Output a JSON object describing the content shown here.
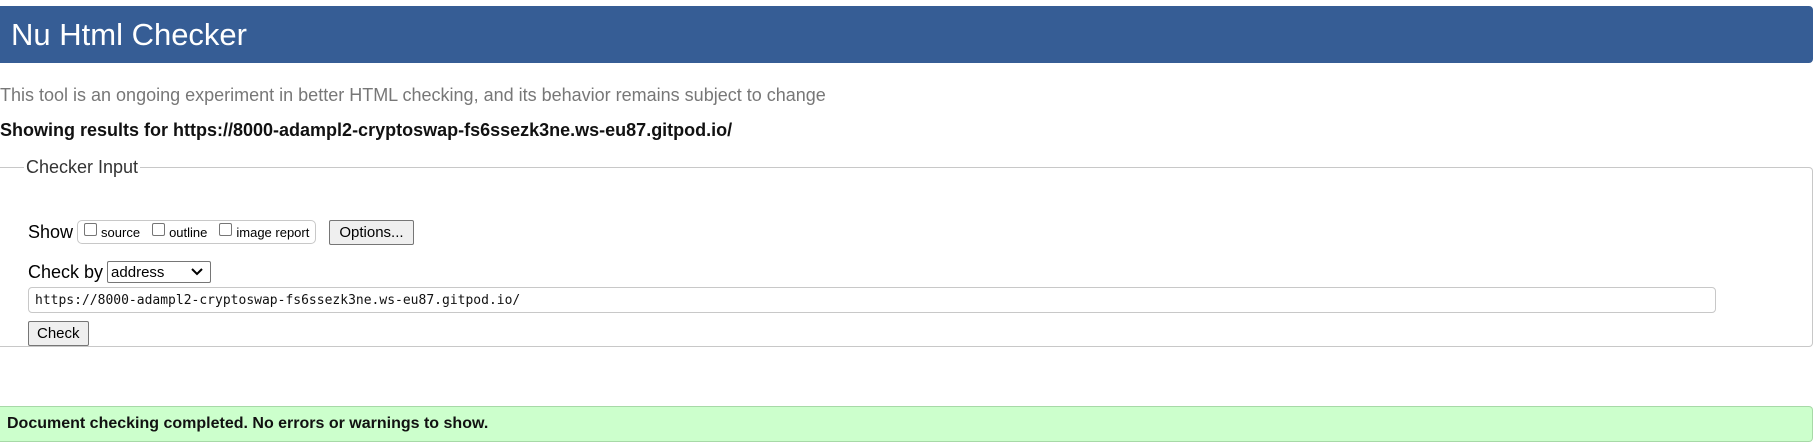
{
  "header": {
    "title": "Nu Html Checker"
  },
  "intro": {
    "subtitle": "This tool is an ongoing experiment in better HTML checking, and its behavior remains subject to change",
    "showing_results": "Showing results for https://8000-adampl2-cryptoswap-fs6ssezk3ne.ws-eu87.gitpod.io/"
  },
  "checker_input": {
    "legend": "Checker Input",
    "show_label": "Show",
    "show_options": [
      {
        "label": "source",
        "checked": false
      },
      {
        "label": "outline",
        "checked": false
      },
      {
        "label": "image report",
        "checked": false
      }
    ],
    "options_button": "Options...",
    "check_by_label": "Check by",
    "check_by_selected": "address",
    "url_value": "https://8000-adampl2-cryptoswap-fs6ssezk3ne.ws-eu87.gitpod.io/",
    "check_button": "Check"
  },
  "result": {
    "message": "Document checking completed. No errors or warnings to show."
  },
  "colors": {
    "header_bg": "#365d95",
    "success_bg": "#ccffcc"
  }
}
